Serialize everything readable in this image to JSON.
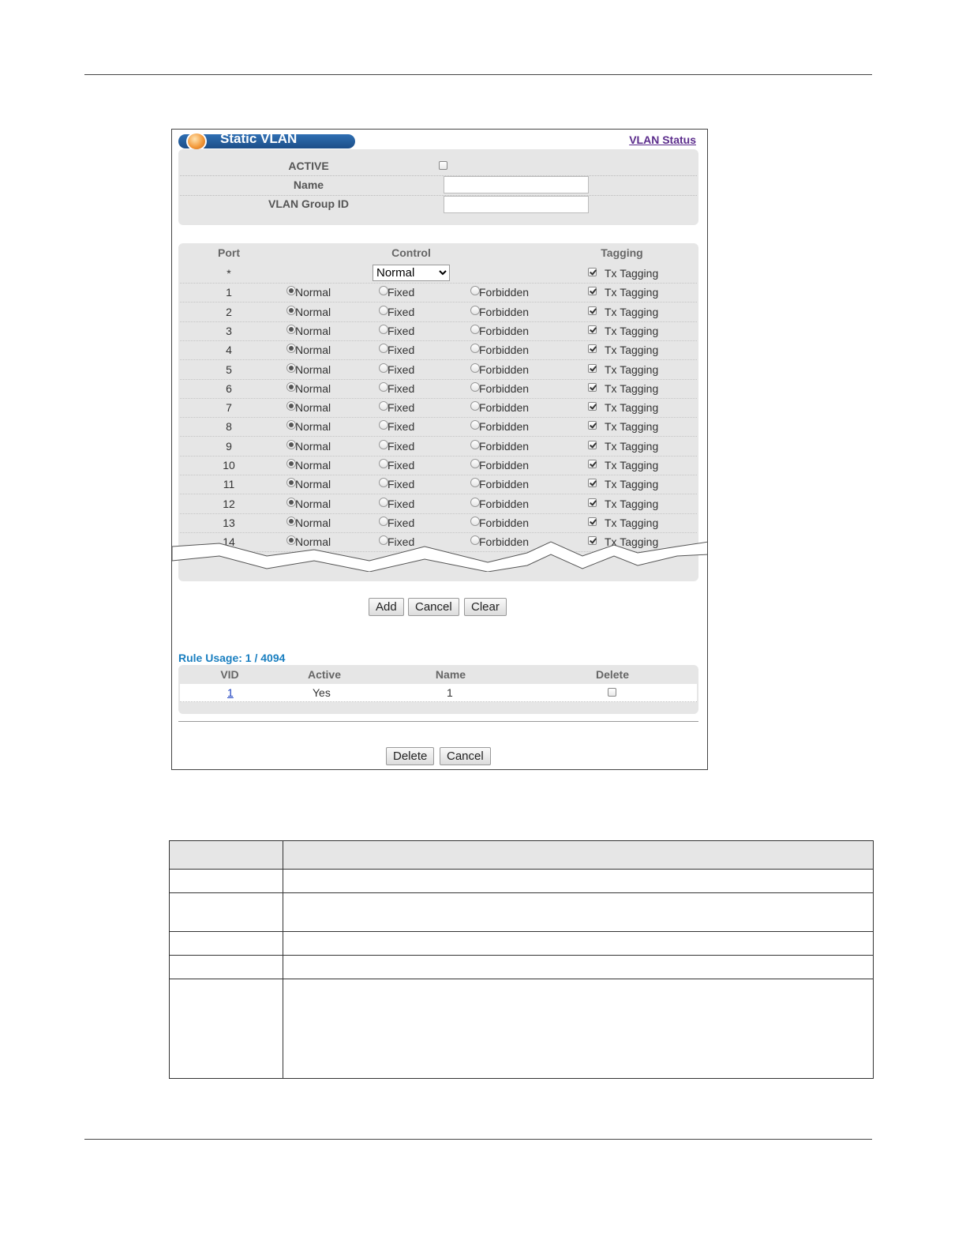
{
  "title": "Static VLAN",
  "status_link": "VLAN Status",
  "form": {
    "active_label": "ACTIVE",
    "name_label": "Name",
    "group_label": "VLAN Group ID"
  },
  "port_table": {
    "headers": {
      "port": "Port",
      "control": "Control",
      "tagging": "Tagging"
    },
    "all_row": {
      "port": "*",
      "control_selected": "Normal",
      "tagging": "Tx Tagging",
      "tagging_checked": true
    },
    "option_labels": {
      "normal": "Normal",
      "fixed": "Fixed",
      "forbidden": "Forbidden",
      "tag": "Tx Tagging"
    },
    "rows": [
      {
        "port": "1",
        "control": "Normal",
        "tagging_checked": true
      },
      {
        "port": "2",
        "control": "Normal",
        "tagging_checked": true
      },
      {
        "port": "3",
        "control": "Normal",
        "tagging_checked": true
      },
      {
        "port": "4",
        "control": "Normal",
        "tagging_checked": true
      },
      {
        "port": "5",
        "control": "Normal",
        "tagging_checked": true
      },
      {
        "port": "6",
        "control": "Normal",
        "tagging_checked": true
      },
      {
        "port": "7",
        "control": "Normal",
        "tagging_checked": true
      },
      {
        "port": "8",
        "control": "Normal",
        "tagging_checked": true
      },
      {
        "port": "9",
        "control": "Normal",
        "tagging_checked": true
      },
      {
        "port": "10",
        "control": "Normal",
        "tagging_checked": true
      },
      {
        "port": "11",
        "control": "Normal",
        "tagging_checked": true
      },
      {
        "port": "12",
        "control": "Normal",
        "tagging_checked": true
      },
      {
        "port": "13",
        "control": "Normal",
        "tagging_checked": true
      },
      {
        "port": "14",
        "control": "Normal",
        "tagging_checked": true
      }
    ]
  },
  "buttons": {
    "add": "Add",
    "cancel": "Cancel",
    "clear": "Clear",
    "delete": "Delete",
    "cancel2": "Cancel"
  },
  "rule_usage": "Rule Usage: 1 / 4094",
  "vlan_table": {
    "headers": {
      "vid": "VID",
      "active": "Active",
      "name": "Name",
      "delete": "Delete"
    },
    "rows": [
      {
        "vid": "1",
        "active": "Yes",
        "name": "1"
      }
    ]
  },
  "colors": {
    "title_bar": "#1d4e88",
    "link_purple": "#5b2c8c",
    "rule_usage_blue": "#1a7fc0"
  }
}
